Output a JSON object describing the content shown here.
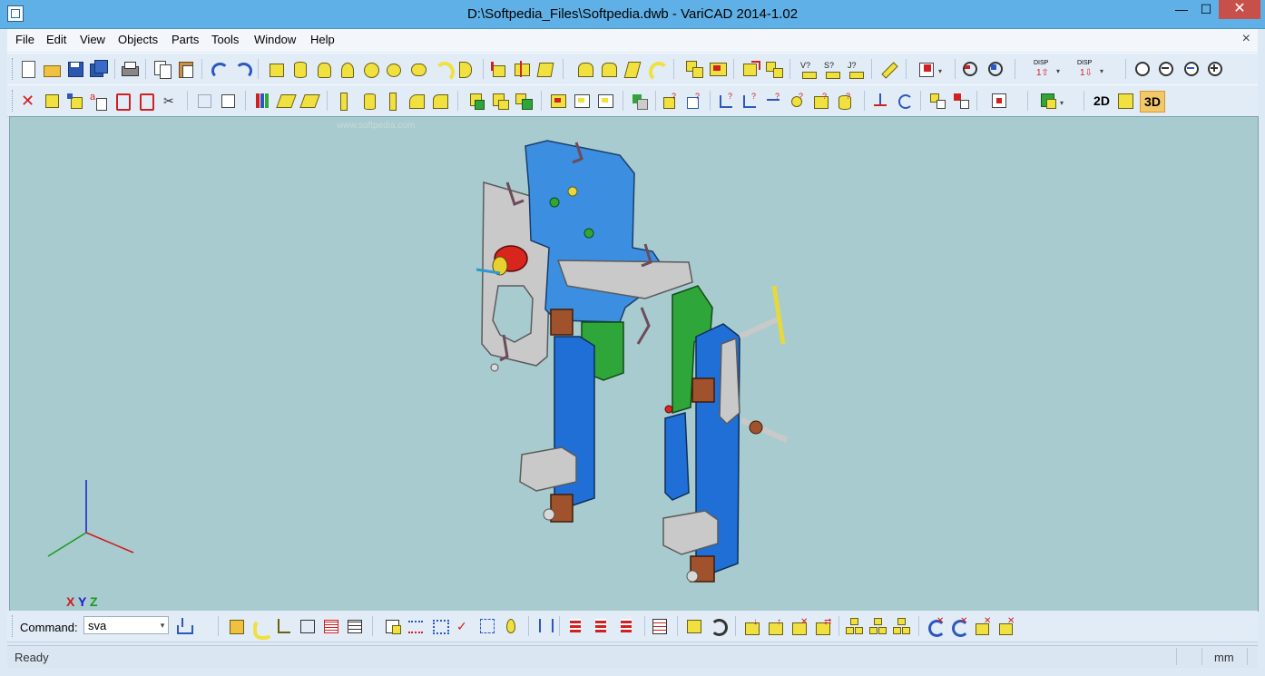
{
  "window": {
    "title": "D:\\Softpedia_Files\\Softpedia.dwb - VariCAD 2014-1.02",
    "minimize_glyph": "—",
    "maximize_glyph": "☐",
    "close_glyph": "✕"
  },
  "menu": {
    "items": [
      "File",
      "Edit",
      "View",
      "Objects",
      "Parts",
      "Tools",
      "Window",
      "Help"
    ],
    "close_glyph": "×"
  },
  "toolbar2": {
    "mode_2d": "2D",
    "mode_3d": "3D"
  },
  "viewport": {
    "watermark": "www.softpedia.com",
    "axes": {
      "x": "X",
      "y": "Y",
      "z": "Z"
    },
    "background_color": "#a8cbcf"
  },
  "command": {
    "label": "Command:",
    "value": "sva"
  },
  "status": {
    "text": "Ready",
    "unit": "mm"
  },
  "colors": {
    "title_bar": "#5fb0e6",
    "plate_blue": "#3b8ee0",
    "tube_blue": "#1f6fd6",
    "green": "#2fa63a",
    "grey": "#c9c9c9",
    "red": "#d8261e",
    "yellow": "#e6d840"
  }
}
